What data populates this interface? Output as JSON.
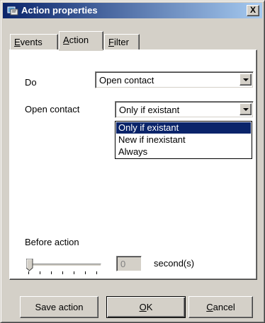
{
  "window": {
    "title": "Action properties",
    "close_label": "X"
  },
  "tabs": [
    {
      "label": "Events",
      "mnemonic": "E",
      "rest": "vents",
      "active": false
    },
    {
      "label": "Action",
      "mnemonic": "A",
      "rest": "ction",
      "active": true
    },
    {
      "label": "Filter",
      "mnemonic": "F",
      "rest": "ilter",
      "active": false
    }
  ],
  "form": {
    "do_label": "Do",
    "do_value": "Open contact",
    "open_contact_label": "Open contact",
    "open_contact_value": "Only if existant",
    "open_contact_options": [
      "Only if existant",
      "New if inexistant",
      "Always"
    ],
    "open_contact_selected_index": 0,
    "before_action_label": "Before action",
    "seconds_value": "0",
    "seconds_unit": "second(s)",
    "slider_level": 0
  },
  "buttons": {
    "save_label": "Save action",
    "ok_label": "OK",
    "ok_mnemonic": "O",
    "ok_rest": "K",
    "cancel_label": "Cancel",
    "cancel_mnemonic": "C",
    "cancel_rest": "ancel"
  },
  "icons": {
    "title_icon": "app-window-icon",
    "close_icon": "close-icon",
    "dropdown_arrow": "chevron-down-icon"
  }
}
